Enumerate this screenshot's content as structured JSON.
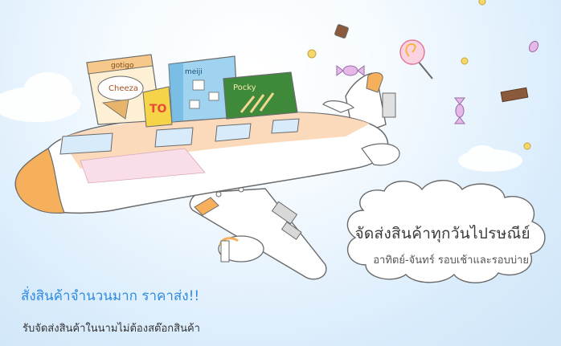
{
  "cloud": {
    "title": "จัดส่งสินค้าทุกวันไปรษณีย์",
    "subtitle": "อาทิตย์-จันทร์  รอบเช้าและรอบบ่าย"
  },
  "promo": {
    "title": "สั่งสินค้าจำนวนมาก  ราคาส่ง!!",
    "subtitle": "รับจัดส่งสินค้าในนามไม่ต้องสต๊อกสินค้า"
  },
  "packages": {
    "gotigo": "gotigo",
    "cheeza": "Cheeza",
    "meiji": "meiji",
    "pocky": "Pocky",
    "toppo": "TO"
  },
  "colors": {
    "sky": "#d8ebfb",
    "plane_body": "#ffffff",
    "plane_stripe": "#fbd8b8",
    "plane_nose": "#f6b05c",
    "promo_blue": "#2f8be0"
  }
}
